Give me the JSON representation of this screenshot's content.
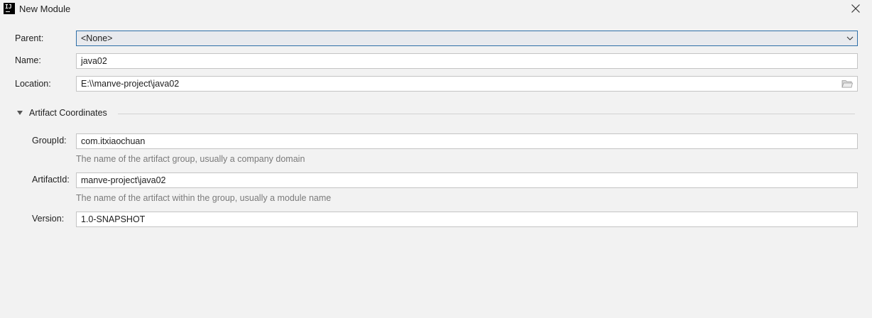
{
  "window": {
    "title": "New Module",
    "app_icon_text": "IJ"
  },
  "form": {
    "parent": {
      "label": "Parent:",
      "value": "<None>"
    },
    "name": {
      "label": "Name:",
      "value": "java02"
    },
    "location": {
      "label": "Location:",
      "value": "E:\\\\manve-project\\java02"
    }
  },
  "artifact": {
    "section_title": "Artifact Coordinates",
    "group_id": {
      "label": "GroupId:",
      "value": "com.itxiaochuan",
      "hint": "The name of the artifact group, usually a company domain"
    },
    "artifact_id": {
      "label": "ArtifactId:",
      "value": "manve-project\\java02",
      "hint": "The name of the artifact within the group, usually a module name"
    },
    "version": {
      "label": "Version:",
      "value": "1.0-SNAPSHOT"
    }
  },
  "icons": {
    "app": "intellij-logo-icon",
    "close": "close-icon",
    "dropdown": "chevron-down-icon",
    "browse": "folder-icon",
    "collapse": "triangle-down-icon"
  },
  "colors": {
    "background": "#f2f2f2",
    "focus_border": "#2e6fa8",
    "hint_text": "#7a7a7a"
  }
}
